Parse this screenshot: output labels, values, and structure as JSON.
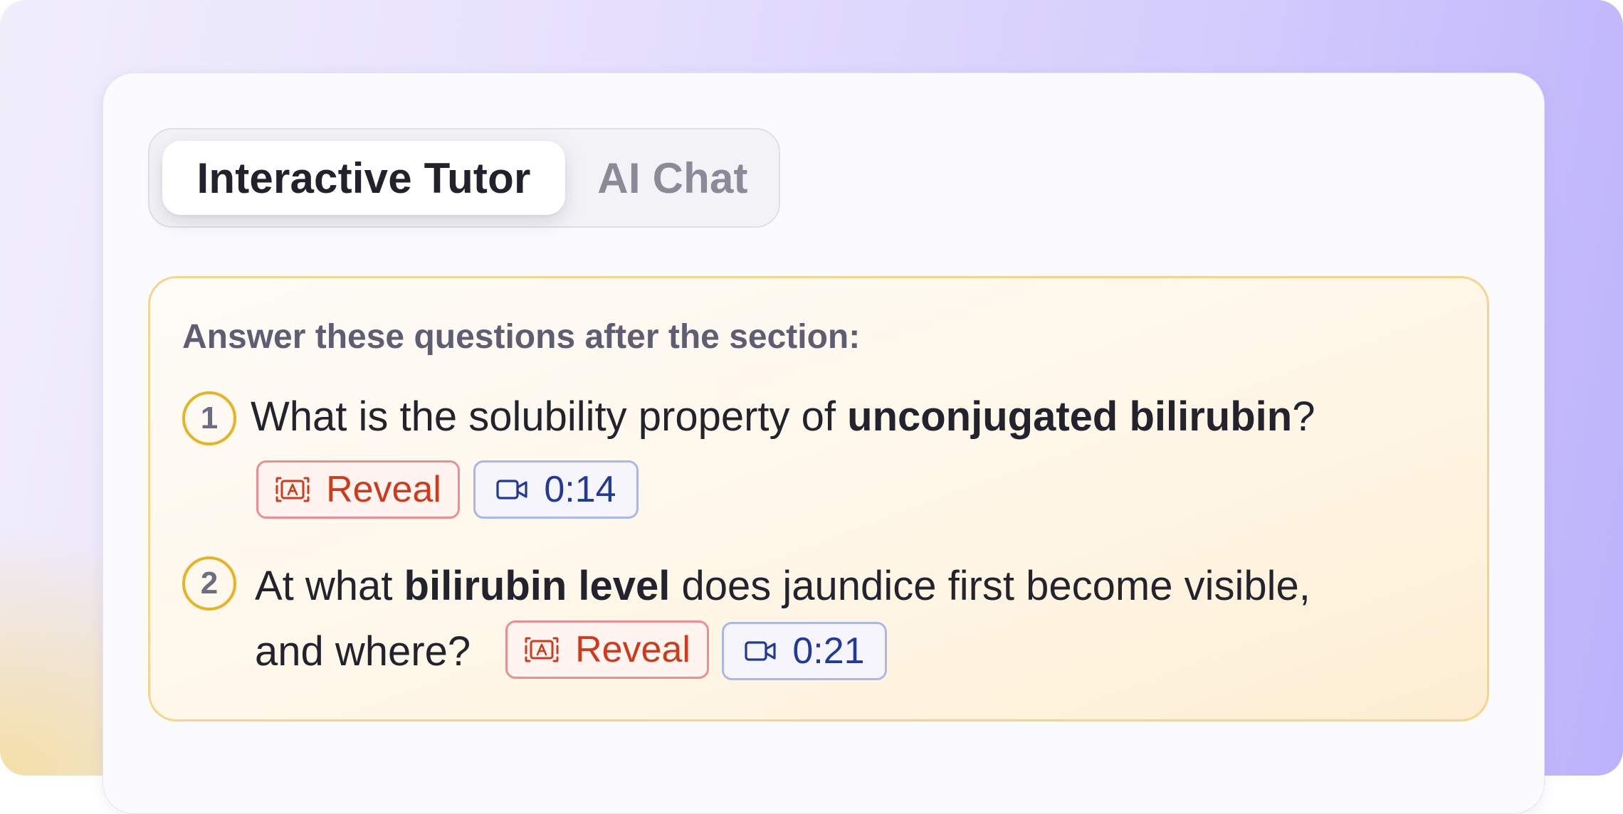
{
  "tabs": {
    "active_label": "Interactive Tutor",
    "inactive_label": "AI Chat"
  },
  "questions_panel": {
    "heading": "Answer these questions after the section:",
    "questions": [
      {
        "number": "1",
        "line1_before": "What is the solubility property of ",
        "line1_bold": "unconjugated bilirubin",
        "line1_after": "?",
        "reveal_label": "Reveal",
        "video_time": "0:14"
      },
      {
        "number": "2",
        "line1_before": "At what ",
        "line1_bold": "bilirubin level",
        "line1_after": " does jaundice first become visible,",
        "line2": "and where?",
        "reveal_label": "Reveal",
        "video_time": "0:21"
      }
    ]
  },
  "colors": {
    "accent_gold": "#e7b323",
    "reveal_red": "#d03a1a",
    "video_blue": "#1f3a9a",
    "panel_border": "#f7d48b"
  },
  "icons": {
    "reveal": "answer-card-icon",
    "video": "video-camera-icon"
  }
}
